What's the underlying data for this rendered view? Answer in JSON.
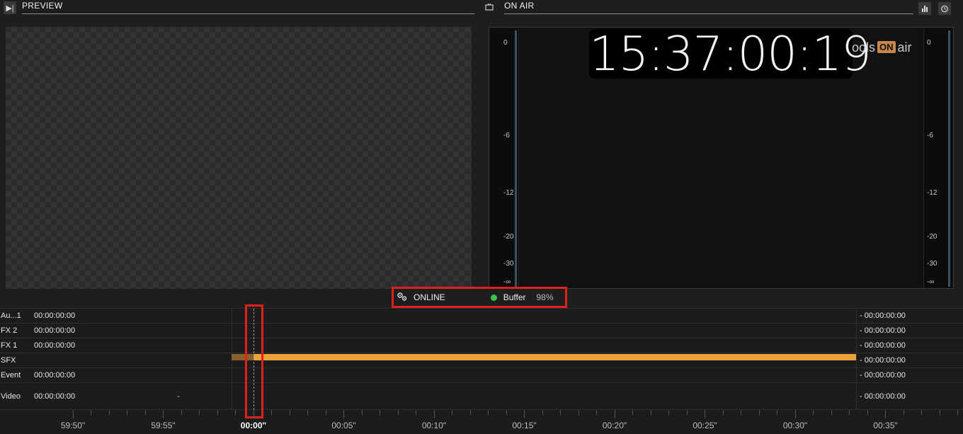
{
  "preview": {
    "title": "PREVIEW",
    "play_glyph": "▶︎|"
  },
  "onair": {
    "title": "ON AIR",
    "tv_glyph": "📺",
    "stats_glyph": "▐▟",
    "alarm_glyph": "⏰",
    "clock": "15:37:00:19",
    "logo_prefix": "ools",
    "logo_on": "ON",
    "logo_suffix": "air",
    "vu_scale": [
      "0",
      "-6",
      "-12",
      "-20",
      "-30",
      "-∞"
    ]
  },
  "status": {
    "label": "ONLINE",
    "buffer_label": "Buffer",
    "buffer_value": "98%",
    "colors": {
      "online_dot": "#3bc24a",
      "highlight": "#e0201c"
    }
  },
  "timeline": {
    "tracks": [
      {
        "name": "Au...1",
        "time": "00:00:00:00",
        "right": "- 00:00:00:00"
      },
      {
        "name": "FX 2",
        "time": "00:00:00:00",
        "right": "- 00:00:00:00"
      },
      {
        "name": "FX 1",
        "time": "00:00:00:00",
        "right": "- 00:00:00:00"
      },
      {
        "name": "SFX",
        "time": "",
        "right": "- 00:00:00:00"
      },
      {
        "name": "Event",
        "time": "00:00:00:00",
        "right": "- 00:00:00:00"
      },
      {
        "name": "Video",
        "time": "00:00:00:00",
        "right": "- 00:00:00:00",
        "extra": "-"
      }
    ],
    "ruler_labels": [
      "59:50\"",
      "59:55\"",
      "00:00\"",
      "00:05\"",
      "00:10\"",
      "00:15\"",
      "00:20\"",
      "00:25\"",
      "00:30\"",
      "00:35\""
    ],
    "current_label": "00:00\"",
    "sfx_color": "#f0a23a"
  }
}
